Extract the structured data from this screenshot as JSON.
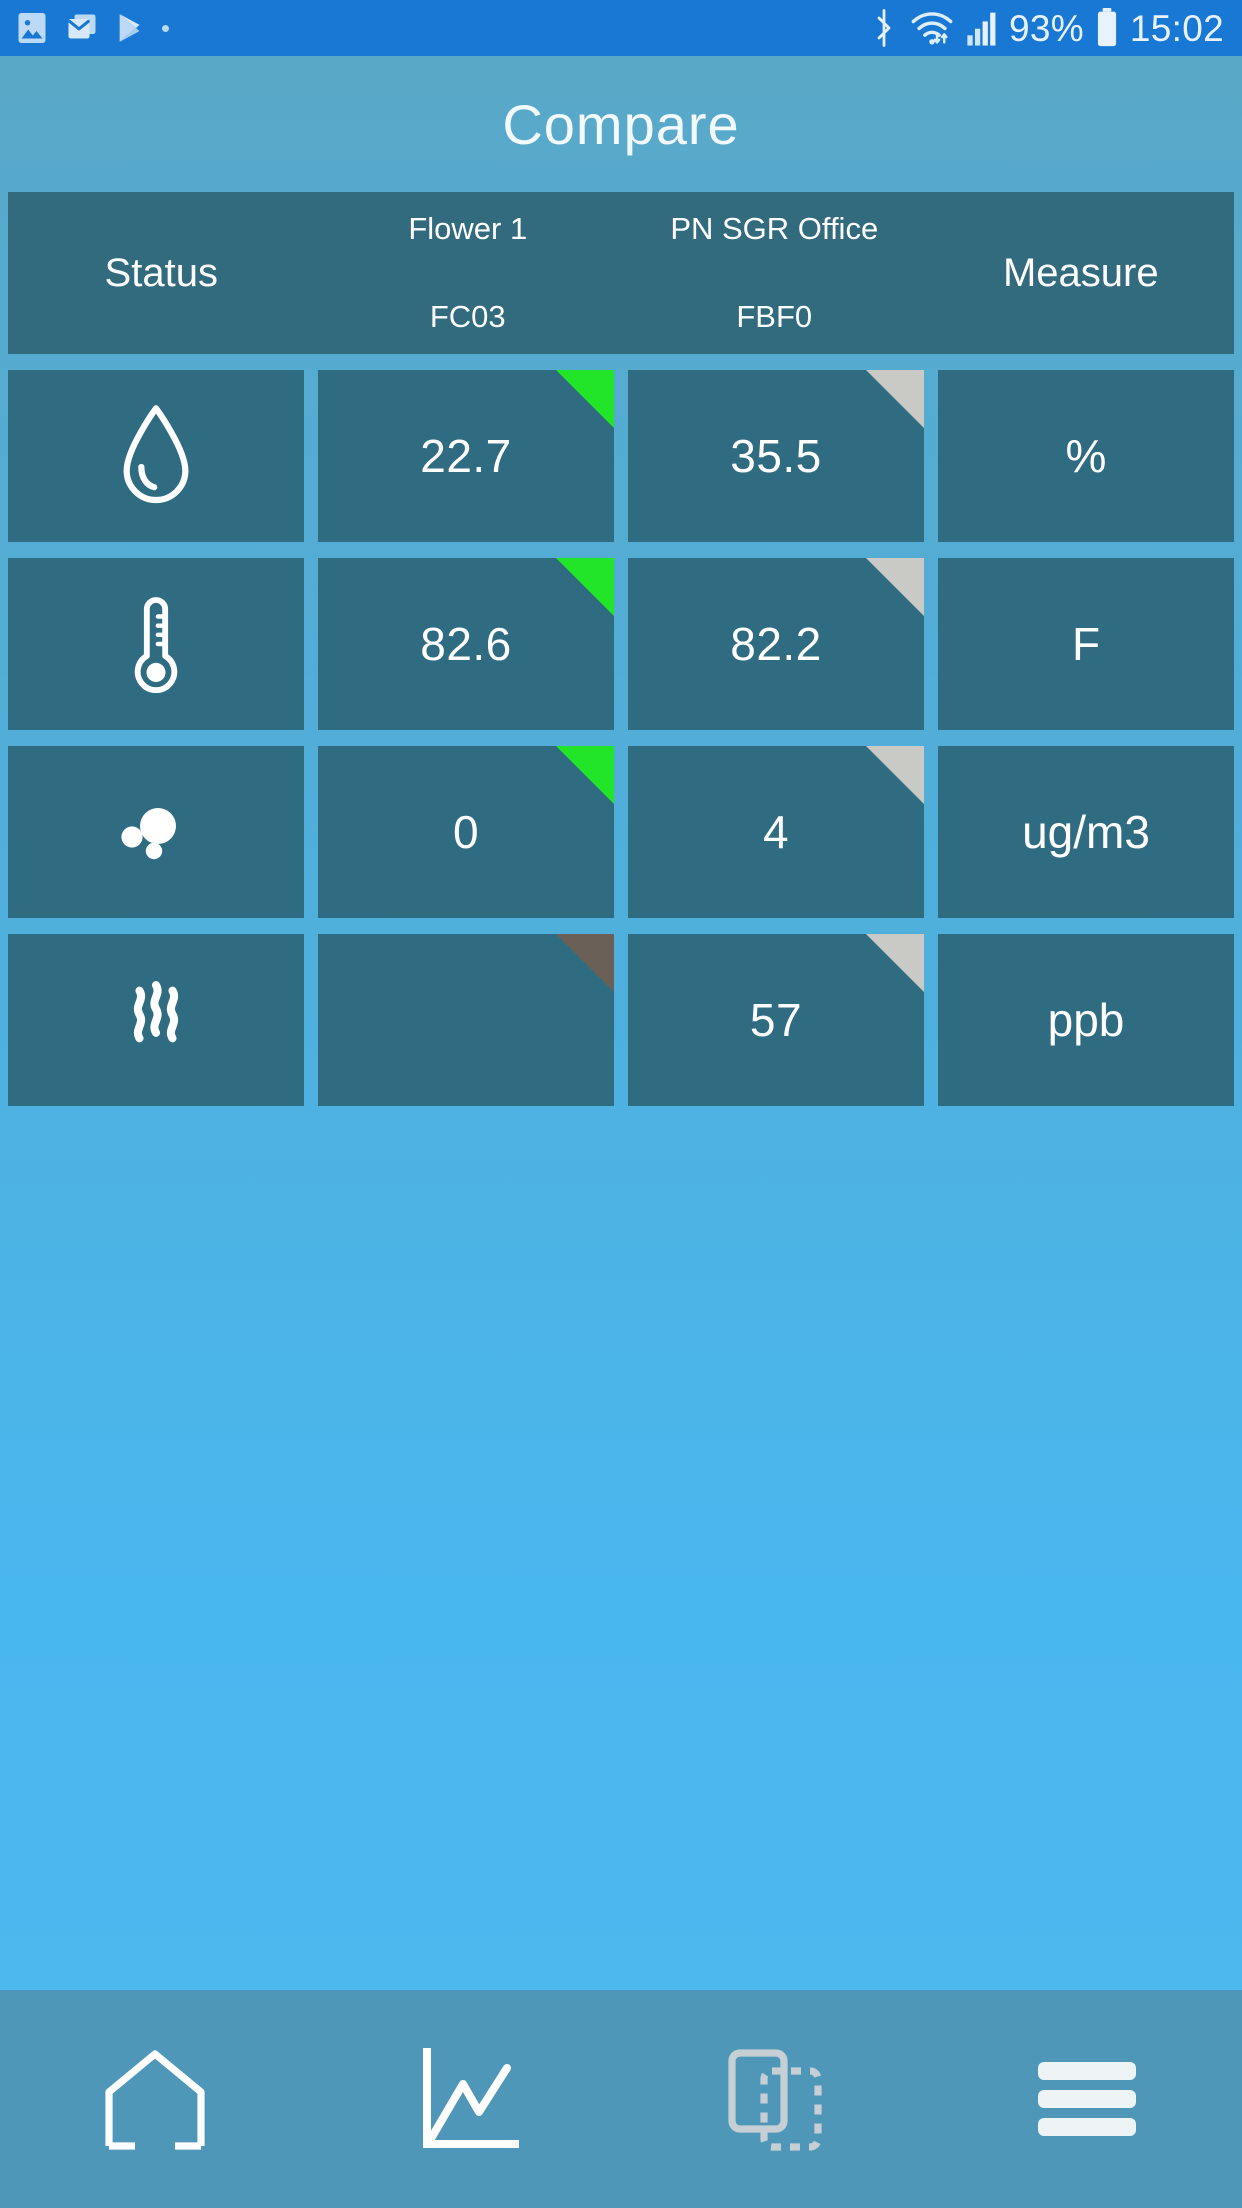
{
  "status_bar": {
    "left_icons": [
      "screenshot-image-icon",
      "email-icon",
      "play-store-icon",
      "small-dot-icon"
    ],
    "right_icons": [
      "bluetooth-icon",
      "wifi-icon",
      "cellular-signal-icon",
      "battery-icon"
    ],
    "battery_percent": "93%",
    "time": "15:02",
    "background_color": "#1878d4"
  },
  "header": {
    "title": "Compare"
  },
  "table": {
    "columns": [
      {
        "label": "Status",
        "sublabel": "",
        "code": "",
        "style": "big"
      },
      {
        "label": "",
        "sublabel": "Flower 1",
        "code": "FC03",
        "style": "stacked"
      },
      {
        "label": "",
        "sublabel": "PN SGR Office",
        "code": "FBF0",
        "style": "stacked"
      },
      {
        "label": "Measure",
        "sublabel": "",
        "code": "",
        "style": "big"
      }
    ],
    "rows": [
      {
        "icon": "water-drop-icon",
        "device1": {
          "value": "22.7",
          "corner": "green"
        },
        "device2": {
          "value": "35.5",
          "corner": "silver"
        },
        "unit": "%"
      },
      {
        "icon": "thermometer-icon",
        "device1": {
          "value": "82.6",
          "corner": "green"
        },
        "device2": {
          "value": "82.2",
          "corner": "silver"
        },
        "unit": "F"
      },
      {
        "icon": "particles-icon",
        "device1": {
          "value": "0",
          "corner": "green"
        },
        "device2": {
          "value": "4",
          "corner": "silver"
        },
        "unit": "ug/m3"
      },
      {
        "icon": "gas-waves-icon",
        "device1": {
          "value": "",
          "corner": "dark"
        },
        "device2": {
          "value": "57",
          "corner": "silver"
        },
        "unit": "ppb"
      }
    ]
  },
  "bottom_nav": {
    "items": [
      {
        "name": "home",
        "icon": "home-icon",
        "active": false
      },
      {
        "name": "chart",
        "icon": "line-chart-icon",
        "active": false
      },
      {
        "name": "compare",
        "icon": "compare-icon",
        "active": true
      },
      {
        "name": "menu",
        "icon": "hamburger-menu-icon",
        "active": false
      }
    ]
  },
  "colors": {
    "status_bar": "#1878d4",
    "cell_background": "#2f6c81",
    "header_background": "#336b7e",
    "nav_background": "#4f97b8",
    "corner_green": "#22e52a",
    "corner_silver": "#c9cac6",
    "corner_dark": "#6b6057"
  }
}
